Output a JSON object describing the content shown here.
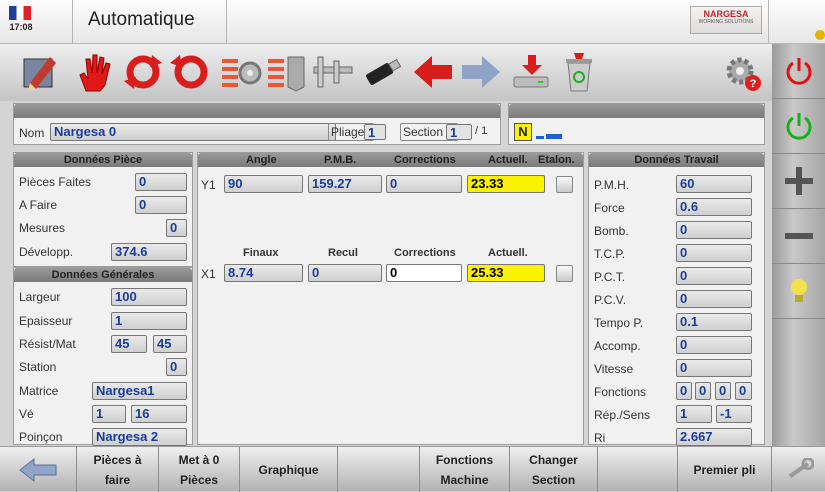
{
  "header": {
    "time": "17:08",
    "title": "Automatique",
    "logo_name": "NARGESA",
    "logo_sub": "WORKING SOLUTIONS"
  },
  "toolbar_icons": [
    "edit-icon",
    "stop-hand-icon",
    "cycle-icon",
    "cycle-reverse-icon",
    "gear-list-icon",
    "list-bend-icon",
    "caliper-icon",
    "usb-icon",
    "arrow-left-icon",
    "arrow-right-icon",
    "download-disk-icon",
    "recycle-bin-icon",
    "gear-alert-icon"
  ],
  "top_section": {
    "nom_label": "Nom",
    "nom_value": "Nargesa 0",
    "pliage_label": "Pliage",
    "pliage_value": "1",
    "section_label": "Section",
    "section_value": "1",
    "section_total": "/ 1",
    "mode_badge": "N"
  },
  "donnees_piece": {
    "title": "Données  Pièce",
    "rows": [
      {
        "label": "Pièces Faites",
        "value": "0"
      },
      {
        "label": "A Faire",
        "value": "0"
      },
      {
        "label": "Mesures",
        "value": "0"
      },
      {
        "label": "Développ.",
        "value": "374.6"
      }
    ]
  },
  "donnees_generales": {
    "title": "Données Générales",
    "largeur_label": "Largeur",
    "largeur": "100",
    "epaisseur_label": "Epaisseur",
    "epaisseur": "1",
    "resist_label": "Résist/Mat",
    "resist_a": "45",
    "resist_b": "45",
    "station_label": "Station",
    "station": "0",
    "matrice_label": "Matrice",
    "matrice": "Nargesa1",
    "ve_label": "Vé",
    "ve_a": "1",
    "ve_b": "16",
    "poincon_label": "Poinçon",
    "poincon": "Nargesa 2"
  },
  "center": {
    "y1": {
      "row_label": "Y1",
      "headers": [
        "Angle",
        "P.M.B.",
        "Corrections",
        "Actuell.",
        "Etalon."
      ],
      "angle": "90",
      "pmb": "159.27",
      "corrections": "0",
      "actuel": "23.33"
    },
    "x1": {
      "row_label": "X1",
      "headers": [
        "Finaux",
        "Recul",
        "Corrections",
        "Actuell."
      ],
      "finaux": "8.74",
      "recul": "0",
      "corrections": "0",
      "actuel": "25.33"
    }
  },
  "donnees_travail": {
    "title": "Données Travail",
    "rows": [
      {
        "label": "P.M.H.",
        "value": "60"
      },
      {
        "label": "Force",
        "value": "0.6"
      },
      {
        "label": "Bomb.",
        "value": "0"
      },
      {
        "label": "T.C.P.",
        "value": "0"
      },
      {
        "label": "P.C.T.",
        "value": "0"
      },
      {
        "label": "P.C.V.",
        "value": "0"
      },
      {
        "label": "Tempo P.",
        "value": "0.1"
      },
      {
        "label": "Accomp.",
        "value": "0"
      },
      {
        "label": "Vitesse",
        "value": "0"
      }
    ],
    "fonctions_label": "Fonctions",
    "fonctions": [
      "0",
      "0",
      "0",
      "0"
    ],
    "repsens_label": "Rép./Sens",
    "repsens_a": "1",
    "repsens_b": "-1",
    "ri_label": "Ri",
    "ri": "2.667"
  },
  "right_buttons": [
    "power-red-icon",
    "power-green-icon",
    "plus-icon",
    "minus-icon",
    "lightbulb-icon"
  ],
  "bottom": {
    "b1a": "Pièces à",
    "b1b": "faire",
    "b2a": "Met à 0",
    "b2b": "Pièces",
    "b3": "Graphique",
    "b4a": "Fonctions",
    "b4b": "Machine",
    "b5a": "Changer",
    "b5b": "Section",
    "b6": "Premier pli"
  },
  "colors": {
    "field_value": "#1a3d9c",
    "active_yellow": "#fbf200",
    "header_gray": "#8a8a8a"
  }
}
